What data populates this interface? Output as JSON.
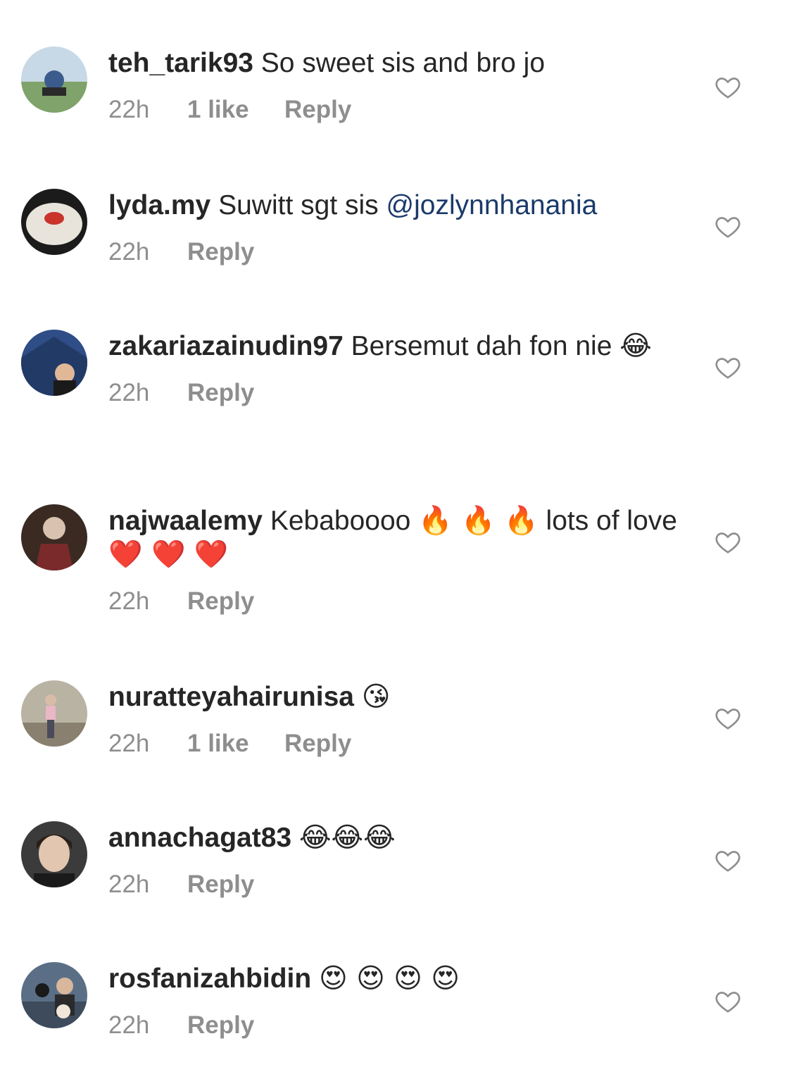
{
  "comments": [
    {
      "username": "teh_tarik93",
      "text": "So sweet sis and bro jo",
      "mention": "",
      "emoji": "",
      "time": "22h",
      "likes": "1 like",
      "reply": "Reply",
      "avatar_colors": [
        "#7fa36a",
        "#3a5b8c"
      ]
    },
    {
      "username": "lyda.my",
      "text": "Suwitt sgt sis",
      "mention": "@jozlynnhanania",
      "emoji": "",
      "time": "22h",
      "likes": "",
      "reply": "Reply",
      "avatar_colors": [
        "#e8e4dc",
        "#c9342b"
      ]
    },
    {
      "username": "zakariazainudin97",
      "text": "Bersemut dah fon nie",
      "mention": "",
      "emoji": "😂",
      "time": "22h",
      "likes": "",
      "reply": "Reply",
      "avatar_colors": [
        "#2f4d86",
        "#1a1a1a"
      ]
    },
    {
      "username": "najwaalemy",
      "text": "Kebaboooo",
      "mention": "",
      "emoji": "🔥 🔥 🔥",
      "text2": "lots of love",
      "emoji2": "❤️ ❤️ ❤️",
      "time": "22h",
      "likes": "",
      "reply": "Reply",
      "avatar_colors": [
        "#7a2a2a",
        "#d9c2b0"
      ]
    },
    {
      "username": "nuratteyahairunisa",
      "text": "",
      "mention": "",
      "emoji": "😘",
      "time": "22h",
      "likes": "1 like",
      "reply": "Reply",
      "avatar_colors": [
        "#b9b3a3",
        "#e9b7c6"
      ]
    },
    {
      "username": "annachagat83",
      "text": "",
      "mention": "",
      "emoji": "😂😂😂",
      "time": "22h",
      "likes": "",
      "reply": "Reply",
      "avatar_colors": [
        "#3b3b3b",
        "#e2c6b0"
      ]
    },
    {
      "username": "rosfanizahbidin",
      "text": "",
      "mention": "",
      "emoji": "😍 😍 😍 😍",
      "time": "22h",
      "likes": "",
      "reply": "Reply",
      "avatar_colors": [
        "#5a6f86",
        "#f0e6da"
      ]
    }
  ],
  "colors": {
    "username": "#262626",
    "meta": "#8e8e8e",
    "mention": "#1b3a6b",
    "heart": "#8e8e8e"
  },
  "icons": {
    "like": "heart-outline-icon"
  }
}
